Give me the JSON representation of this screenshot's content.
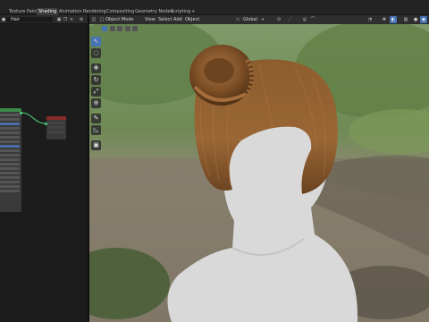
{
  "workspace_tabs": [
    {
      "label": "Texture Paint",
      "active": false
    },
    {
      "label": "Shading",
      "active": true
    },
    {
      "label": "Animation",
      "active": false
    },
    {
      "label": "Rendering",
      "active": false
    },
    {
      "label": "Compositing",
      "active": false
    },
    {
      "label": "Geometry Nodes",
      "active": false
    },
    {
      "label": "Scripting",
      "active": false
    },
    {
      "label": "+",
      "active": false
    }
  ],
  "node_editor": {
    "material_name": "Hair"
  },
  "viewport_header": {
    "mode_label": "Object Mode",
    "menus": [
      "View",
      "Select",
      "Add",
      "Object"
    ],
    "orientation_label": "Global"
  },
  "colors": {
    "accent": "#4772b3",
    "hair": "#8a5a2b",
    "mannequin": "#d9d9d9",
    "node_header_green": "#3c8a4a"
  },
  "icons": {
    "toolbar": [
      "select-cursor-icon",
      "cursor-icon",
      "move-icon",
      "rotate-icon",
      "scale-icon",
      "transform-icon",
      "annotate-icon",
      "measure-icon",
      "add-cube-icon"
    ]
  }
}
